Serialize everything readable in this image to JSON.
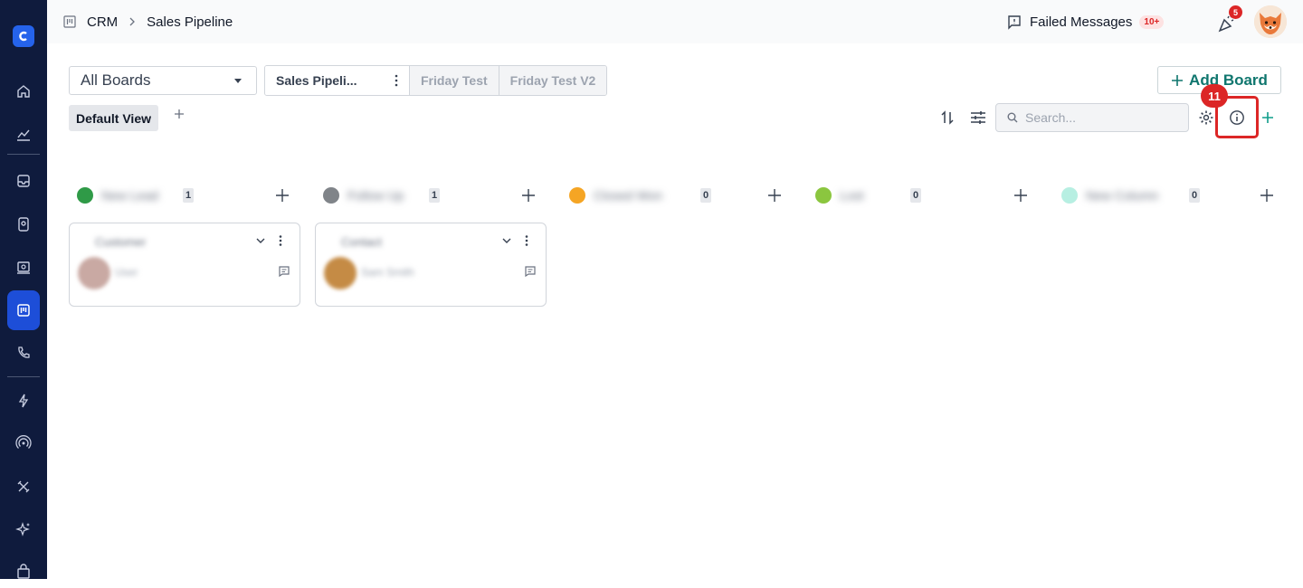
{
  "breadcrumb": {
    "root": "CRM",
    "current": "Sales Pipeline"
  },
  "header": {
    "failed_messages_label": "Failed Messages",
    "failed_messages_badge": "10+",
    "notifications_count": "5"
  },
  "toolbar": {
    "board_select_value": "All Boards",
    "board_tabs": [
      {
        "label": "Sales Pipeli...",
        "active": true
      },
      {
        "label": "Friday Test",
        "active": false
      },
      {
        "label": "Friday Test V2",
        "active": false
      }
    ],
    "add_board_label": "Add Board",
    "view_tab_label": "Default View",
    "search_placeholder": "Search...",
    "step_badge": "11"
  },
  "columns": [
    {
      "name": "New Lead",
      "count": "1",
      "color": "#2f9a47"
    },
    {
      "name": "Follow Up",
      "count": "1",
      "color": "#808489"
    },
    {
      "name": "Closed Won",
      "count": "0",
      "color": "#f5a524"
    },
    {
      "name": "Lost",
      "count": "0",
      "color": "#8bc63f"
    },
    {
      "name": "New Column",
      "count": "0",
      "color": "#b7efe2"
    }
  ],
  "cards": [
    {
      "title": "Customer",
      "user": "User",
      "avatar_color": "#c9a9a3"
    },
    {
      "title": "Contact",
      "user": "Sam Smith",
      "avatar_color": "#c58b45"
    }
  ],
  "colors": {
    "sidebar_bg": "#0f1b3d",
    "sidebar_active": "#1d4ed8",
    "accent_teal": "#0f766e",
    "highlight_red": "#dc2626"
  }
}
